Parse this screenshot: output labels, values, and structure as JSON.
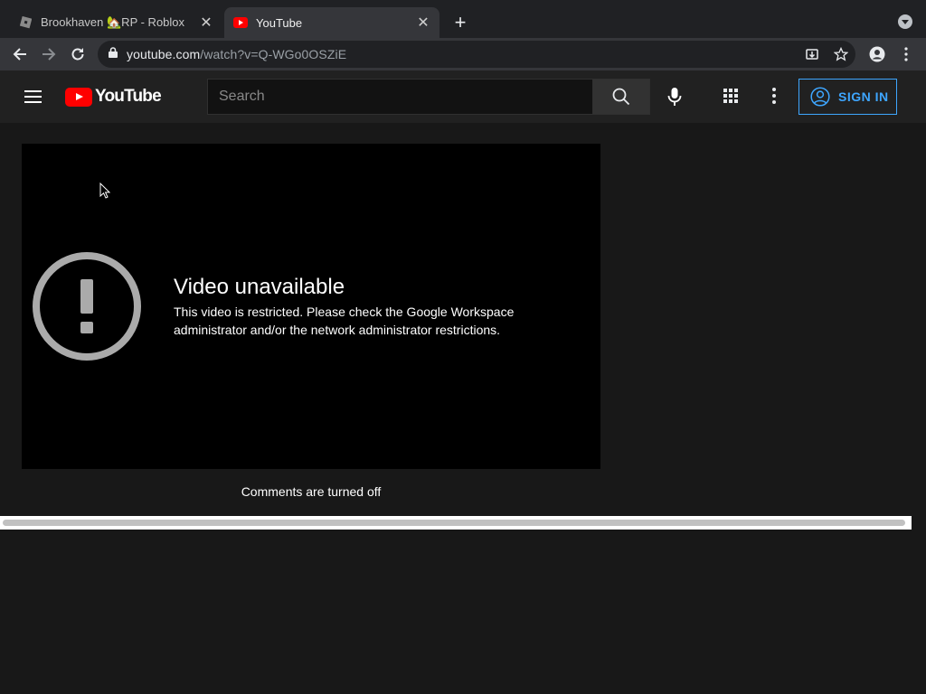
{
  "browser": {
    "tabs": [
      {
        "title": "Brookhaven 🏡RP - Roblox",
        "active": false,
        "icon": "roblox-icon"
      },
      {
        "title": "YouTube",
        "active": true,
        "icon": "youtube-favicon-icon"
      }
    ],
    "url_domain": "youtube.com",
    "url_path": "/watch?v=Q-WGo0OSZiE"
  },
  "header": {
    "logo_text": "YouTube",
    "search_placeholder": "Search",
    "signin_label": "SIGN IN"
  },
  "player": {
    "error_title": "Video unavailable",
    "error_message": "This video is restricted. Please check the Google Workspace administrator and/or the network administrator restrictions."
  },
  "comments": {
    "status": "Comments are turned off"
  },
  "colors": {
    "background": "#181818",
    "header": "#212121",
    "accent_blue": "#3ea6ff",
    "brand_red": "#ff0000"
  }
}
